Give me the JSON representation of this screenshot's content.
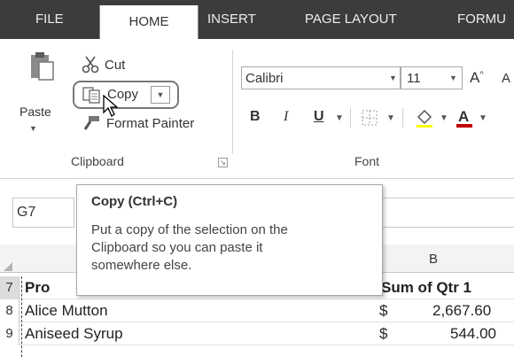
{
  "ribbon": {
    "tabs": [
      {
        "label": "FILE"
      },
      {
        "label": "HOME"
      },
      {
        "label": "INSERT"
      },
      {
        "label": "PAGE LAYOUT"
      },
      {
        "label": "FORMU"
      }
    ],
    "clipboard": {
      "paste_label": "Paste",
      "cut_label": "Cut",
      "copy_label": "Copy",
      "format_painter_label": "Format Painter",
      "group_label": "Clipboard"
    },
    "font": {
      "font_name": "Calibri",
      "font_size": "11",
      "bold": "B",
      "italic": "I",
      "underline": "U",
      "grow_label": "A",
      "shrink_label": "A",
      "group_label": "Font"
    }
  },
  "formula_bar": {
    "name_box": "G7"
  },
  "tooltip": {
    "title": "Copy (Ctrl+C)",
    "lines": [
      "Put a copy of the selection on the",
      "Clipboard so you can paste it",
      "somewhere else."
    ]
  },
  "grid": {
    "col_b": "B",
    "rows": [
      {
        "num": "7",
        "a": "Pro",
        "currency": "",
        "value": "Sum of Qtr 1"
      },
      {
        "num": "8",
        "a": "Alice Mutton",
        "currency": "$",
        "value": "2,667.60"
      },
      {
        "num": "9",
        "a": "Aniseed Syrup",
        "currency": "$",
        "value": "544.00"
      }
    ]
  },
  "colors": {
    "tab_bar": "#3c3c3c",
    "ribbon": "#ffffff",
    "font_color_accent": "#c00000"
  },
  "icons": [
    "paste-icon",
    "scissors-icon",
    "copy-icon",
    "format-painter-icon",
    "borders-icon",
    "fill-color-icon",
    "font-color-icon",
    "dialog-launcher-icon",
    "mouse-cursor-icon"
  ]
}
